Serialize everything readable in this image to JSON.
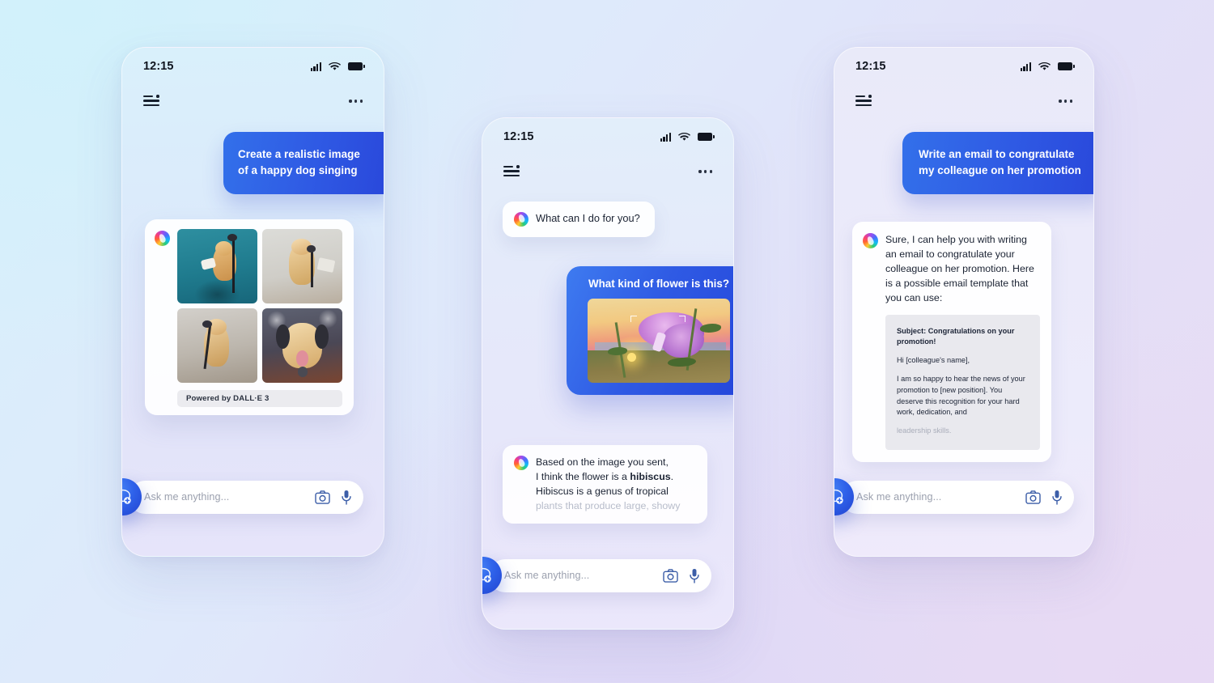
{
  "theme": {
    "accent_blue": "#2f5ae4",
    "bubble_blue_light": "#3370ea",
    "bg_top_left": "#d1f1fb",
    "bg_bottom_right": "#e7d9f4",
    "text_dark": "#1b2333",
    "text_muted": "#b7bcca"
  },
  "common": {
    "status_time": "12:15",
    "signal_icon": "signal-bars-icon",
    "wifi_icon": "wifi-icon",
    "battery_icon": "battery-icon",
    "menu_icon": "hamburger-menu-icon",
    "more_icon": "more-options-icon",
    "copilot_icon": "copilot-logo-icon",
    "camera_icon": "camera-icon",
    "mic_icon": "microphone-icon",
    "new_chat_icon": "new-chat-bubble-icon",
    "composer_placeholder": "Ask me anything..."
  },
  "phones": [
    {
      "id": "phone-image-generation",
      "user_message": "Create a realistic image\nof a happy dog singing",
      "image_card": {
        "badge": "Powered by DALL·E 3",
        "images": [
          {
            "alt": "dog singing into microphone on teal background holding sheet music"
          },
          {
            "alt": "golden retriever singing into microphone on grey background"
          },
          {
            "alt": "golden retriever singing into microphone studio portrait"
          },
          {
            "alt": "dog with headphones singing into microphone on stage"
          }
        ]
      }
    },
    {
      "id": "phone-flower-identification",
      "ai_greeting": "What can I do for you?",
      "user_question": "What kind of flower is this?",
      "attached_image": {
        "alt": "purple hibiscus flower at sunset"
      },
      "ai_answer_lines": [
        {
          "text": "Based on the image you sent,",
          "style": "normal"
        },
        {
          "text": "I think the flower is a ",
          "bold": "hibiscus",
          "suffix": ".",
          "style": "normal"
        },
        {
          "text": "Hibiscus is a genus of tropical",
          "style": "normal"
        },
        {
          "text": "plants that produce large, showy",
          "style": "faded"
        }
      ]
    },
    {
      "id": "phone-email-writing",
      "user_message": "Write an email to congratulate\nmy colleague on her promotion",
      "ai_intro": "Sure, I can help you with writing an email to congratulate your colleague on her promotion. Here is a possible email template that you can use:",
      "email_template": [
        {
          "text": "Subject: Congratulations on your promotion!",
          "style": "subject"
        },
        {
          "text": "Hi [colleague's name],",
          "style": "normal"
        },
        {
          "text": "I am so happy to hear the news of your promotion to [new position]. You deserve this recognition for your hard work, dedication, and",
          "style": "normal"
        },
        {
          "text": "leadership skills.",
          "style": "faded"
        }
      ]
    }
  ]
}
